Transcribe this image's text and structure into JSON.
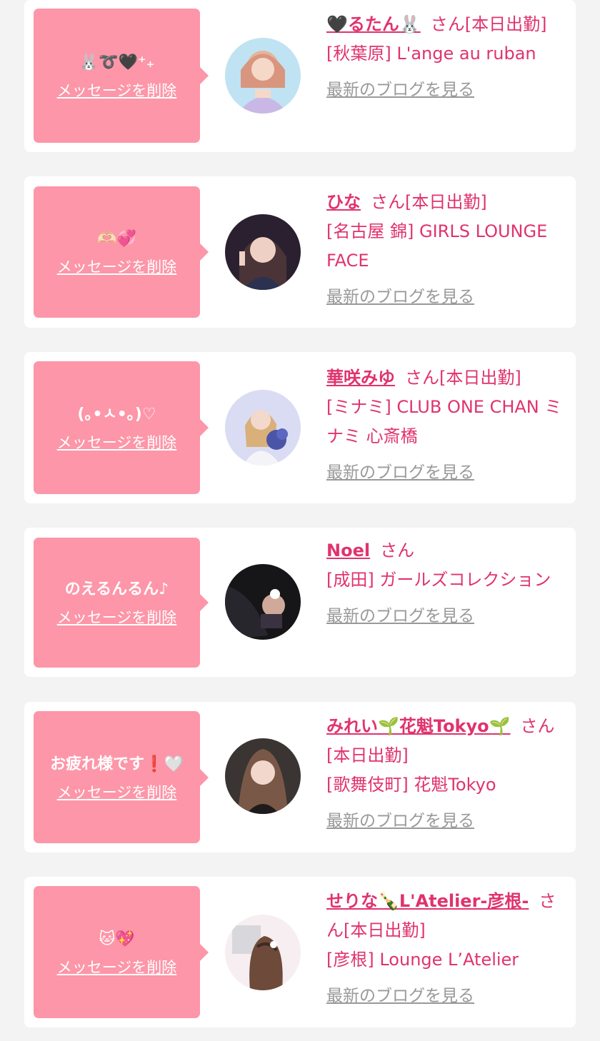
{
  "suffix_san": "さん",
  "blog_label": "最新のブログを見る",
  "delete_label": "メッセージを削除",
  "accent_color": "#e0336e",
  "bubble_color": "#fd96a8",
  "cards": [
    {
      "message": "🐰➰🖤⁺₊",
      "name": "🖤るたん🐰",
      "status": "[本日出勤]",
      "shop": "[秋葉原] L'ange au ruban"
    },
    {
      "message": "🫶🏻💞",
      "name": "ひな",
      "status": "[本日出勤]",
      "shop": "[名古屋 錦] GIRLS LOUNGE FACE"
    },
    {
      "message": "(｡•ㅅ•｡)♡",
      "name": "華咲みゆ",
      "status": "[本日出勤]",
      "shop": "[ミナミ] CLUB ONE CHAN ミナミ 心斎橋"
    },
    {
      "message": "のえるんるん♪",
      "name": "Noel",
      "status": "",
      "shop": "[成田] ガールズコレクション"
    },
    {
      "message": "お疲れ様です❗️🤍",
      "name": "みれい🌱花魁Tokyo🌱",
      "status": "[本日出勤]",
      "shop": "[歌舞伎町] 花魁Tokyo"
    },
    {
      "message": "🐱💖",
      "name": "せりな🍾L'Atelier-彦根-",
      "status": "[本日出勤]",
      "shop": "[彦根] Lounge L’Atelier"
    }
  ]
}
